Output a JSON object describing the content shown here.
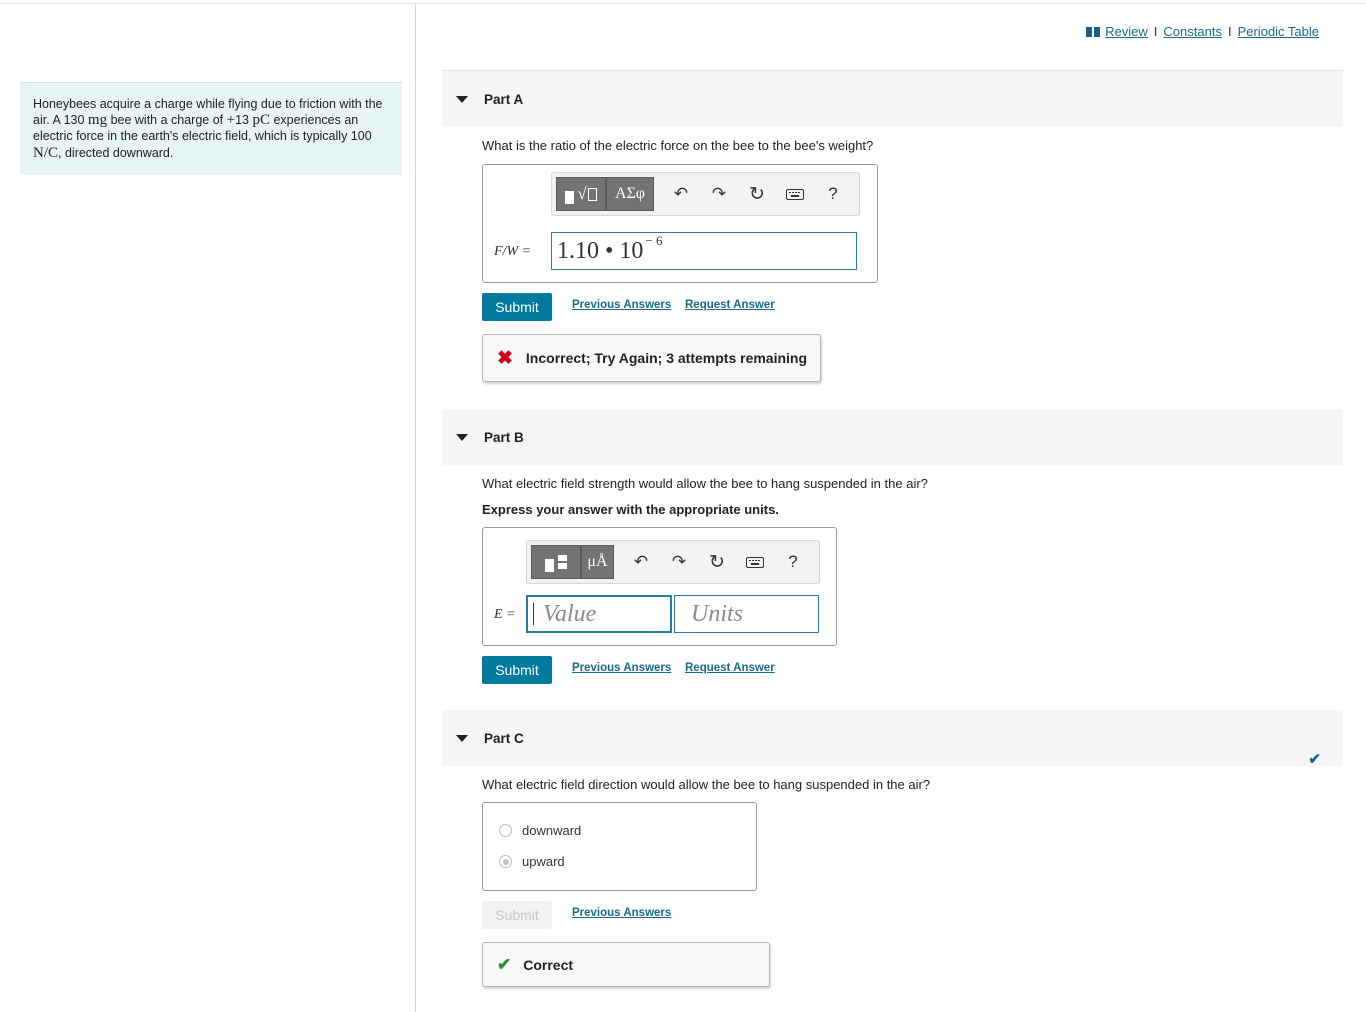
{
  "top_links": {
    "review": "Review",
    "sep": "I",
    "constants": "Constants",
    "periodic_table": "Periodic Table"
  },
  "problem": {
    "t1": "Honeybees acquire a charge while flying due to friction with the air. A 130 ",
    "mass_unit": "mg",
    "t2": " bee with a charge of ",
    "charge_sign": "+",
    "charge_value": "13 ",
    "charge_unit": "pC",
    "t3": " experiences an electric force in the earth's electric field, which is typically ",
    "field_value": "100 ",
    "field_unit": "N/C",
    "t4": ", directed downward."
  },
  "part_a": {
    "title": "Part A",
    "question": "What is the ratio of the electric force on the bee to the bee's weight?",
    "var_label": "F/W =",
    "answer_mantissa": "1.10 • 10",
    "answer_exponent": "− 6",
    "toolbar_greek": "ΑΣφ",
    "help": "?",
    "submit": "Submit",
    "previous_answers": "Previous Answers",
    "request_answer": "Request Answer",
    "feedback": "Incorrect; Try Again; 3 attempts remaining"
  },
  "part_b": {
    "title": "Part B",
    "question": "What electric field strength would allow the bee to hang suspended in the air?",
    "instruction": "Express your answer with the appropriate units.",
    "var_label": "E =",
    "value_placeholder": "Value",
    "units_placeholder": "Units",
    "toolbar_units": "μÅ",
    "help": "?",
    "submit": "Submit",
    "previous_answers": "Previous Answers",
    "request_answer": "Request Answer"
  },
  "part_c": {
    "title": "Part C",
    "question": "What electric field direction would allow the bee to hang suspended in the air?",
    "options": [
      "downward",
      "upward"
    ],
    "selected": "upward",
    "submit": "Submit",
    "previous_answers": "Previous Answers",
    "feedback": "Correct"
  },
  "colors": {
    "accent": "#007b9e",
    "link": "#1a6b8a",
    "error": "#d0021b",
    "success": "#2e8b3a",
    "problem_bg": "#e6f4f5"
  }
}
